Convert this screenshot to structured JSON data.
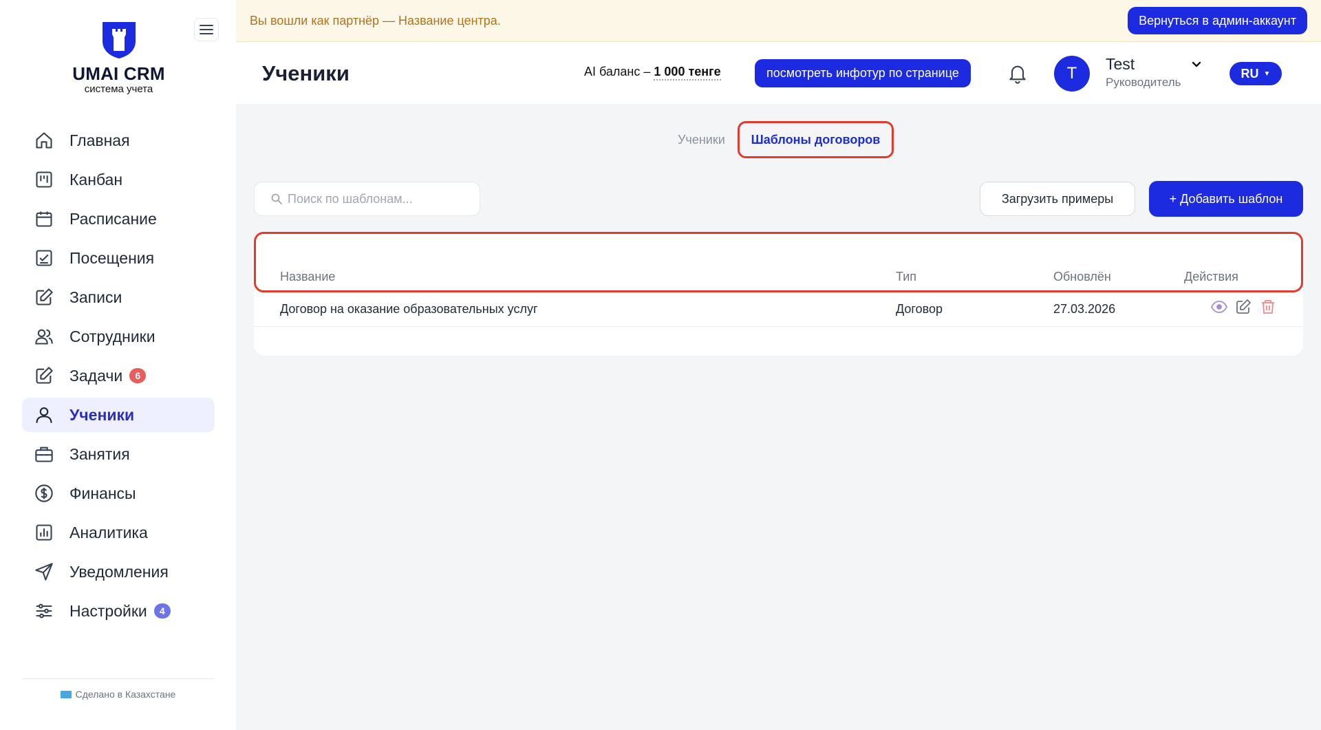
{
  "sidebar": {
    "brand": "UMAI CRM",
    "subtitle": "система учета",
    "items": [
      {
        "label": "Главная",
        "icon": "home-icon"
      },
      {
        "label": "Канбан",
        "icon": "kanban-icon"
      },
      {
        "label": "Расписание",
        "icon": "calendar-icon"
      },
      {
        "label": "Посещения",
        "icon": "attendance-icon"
      },
      {
        "label": "Записи",
        "icon": "edit-note-icon"
      },
      {
        "label": "Сотрудники",
        "icon": "users-icon"
      },
      {
        "label": "Задачи",
        "icon": "tasks-icon",
        "badge": "6"
      },
      {
        "label": "Ученики",
        "icon": "user-icon",
        "active": true
      },
      {
        "label": "Занятия",
        "icon": "briefcase-icon"
      },
      {
        "label": "Финансы",
        "icon": "dollar-icon"
      },
      {
        "label": "Аналитика",
        "icon": "chart-icon"
      },
      {
        "label": "Уведомления",
        "icon": "send-icon"
      },
      {
        "label": "Настройки",
        "icon": "sliders-icon",
        "badge": "4"
      }
    ],
    "footer": "Сделано в Казахстане"
  },
  "banner": {
    "text": "Вы вошли как партнёр — Название центра.",
    "button": "Вернуться в админ-аккаунт"
  },
  "header": {
    "title": "Ученики",
    "ai_label": "AI баланс –",
    "ai_amount": "1 000 тенге",
    "tour_button": "посмотреть инфотур по странице",
    "user_initial": "T",
    "user_name": "Test",
    "user_role": "Руководитель",
    "lang": "RU"
  },
  "tabs": {
    "students": "Ученики",
    "templates": "Шаблоны договоров"
  },
  "toolbar": {
    "search_placeholder": "Поиск по шаблонам...",
    "load_button": "Загрузить примеры",
    "add_button": "+ Добавить шаблон"
  },
  "table": {
    "columns": [
      "Название",
      "Тип",
      "Обновлён",
      "Действия"
    ],
    "rows": [
      {
        "name": "Договор на оказание образовательных услуг",
        "type": "Договор",
        "updated": "27.03.2026"
      }
    ]
  },
  "colors": {
    "accent": "#1c2be0",
    "highlight": "#e23b2e",
    "banner_bg": "#fdf7e8",
    "view_icon": "#a78bda",
    "delete_icon": "#e88a8a"
  }
}
